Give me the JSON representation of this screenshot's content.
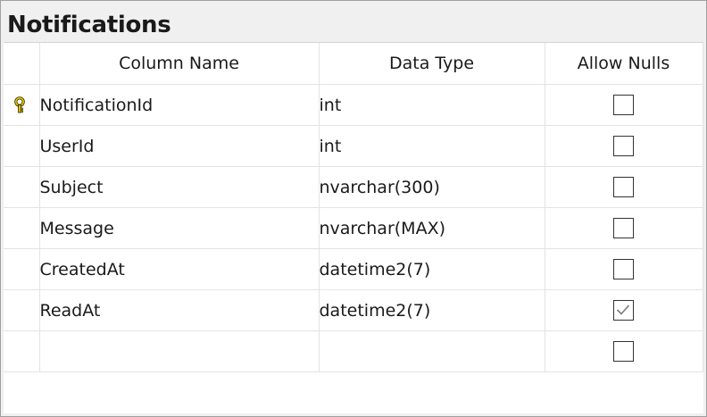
{
  "table_title": "Notifications",
  "columns": {
    "name": "Column Name",
    "type": "Data Type",
    "nulls": "Allow Nulls"
  },
  "rows": [
    {
      "name": "NotificationId",
      "type": "int",
      "allow_nulls": false,
      "primary_key": true
    },
    {
      "name": "UserId",
      "type": "int",
      "allow_nulls": false,
      "primary_key": false
    },
    {
      "name": "Subject",
      "type": "nvarchar(300)",
      "allow_nulls": false,
      "primary_key": false
    },
    {
      "name": "Message",
      "type": "nvarchar(MAX)",
      "allow_nulls": false,
      "primary_key": false
    },
    {
      "name": "CreatedAt",
      "type": "datetime2(7)",
      "allow_nulls": false,
      "primary_key": false
    },
    {
      "name": "ReadAt",
      "type": "datetime2(7)",
      "allow_nulls": true,
      "primary_key": false
    },
    {
      "name": "",
      "type": "",
      "allow_nulls": false,
      "primary_key": false
    }
  ],
  "colors": {
    "key_icon": "#d8b400",
    "checkmark": "#7a7a7a"
  }
}
